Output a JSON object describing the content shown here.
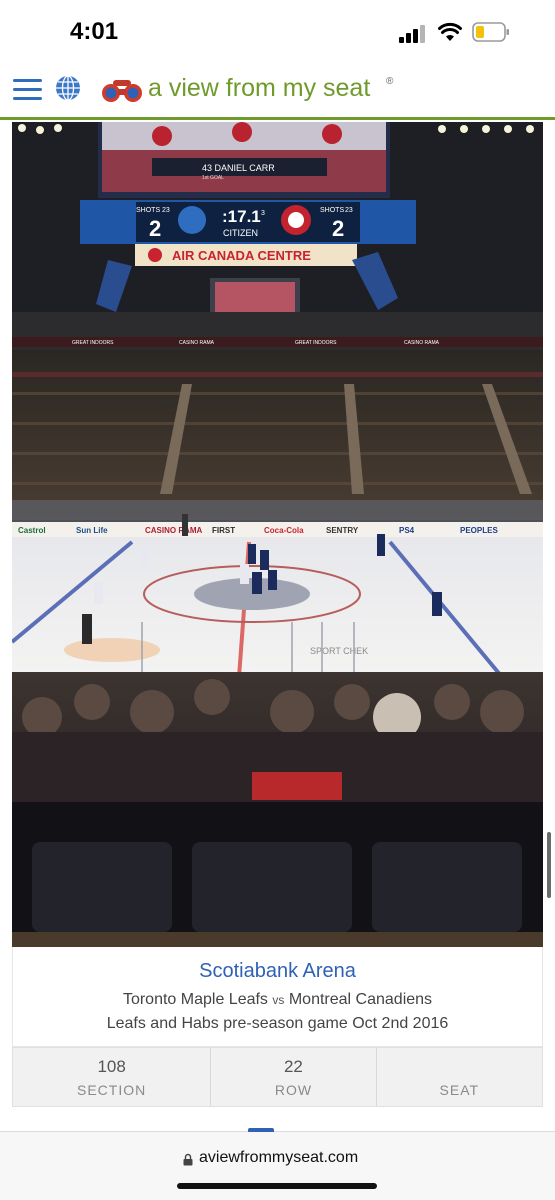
{
  "status_bar": {
    "time": "4:01",
    "icons": [
      "cellular-signal-icon",
      "wifi-icon",
      "battery-low-icon"
    ]
  },
  "header": {
    "menu_icon": "hamburger-menu-icon",
    "globe_icon": "globe-icon",
    "logo_icon": "binoculars-icon",
    "site_name": "a view from my seat",
    "registered_mark": "®",
    "accent_color": "#6f9a2c",
    "link_color": "#2f62b5"
  },
  "photo": {
    "scoreboard": {
      "away_shots_label": "SHOTS",
      "away_shots": "23",
      "away_score": "2",
      "clock": ":17.1",
      "period": "3",
      "sponsor": "CITIZEN",
      "home_shots_label": "SHOTS",
      "home_shots": "23",
      "home_score": "2",
      "player_caption": "43 DANIEL CARR",
      "player_subcaption": "1st GOAL",
      "arena_banner": "AIR CANADA CENTRE"
    },
    "board_ads": [
      "Castrol",
      "Sun Life",
      "CASINO RAMA",
      "FIRST",
      "Coca-Cola",
      "SENTRY",
      "PS4",
      "PEOPLES"
    ],
    "ice_ad": "SPORT CHEK",
    "ring_ads": [
      "GREAT INDOORS",
      "CASINO RAMA",
      "GREAT INDOORS",
      "CASINO RAMA"
    ]
  },
  "caption": {
    "venue": "Scotiabank Arena",
    "home_team": "Toronto Maple Leafs",
    "vs": "vs",
    "away_team": "Montreal Canadiens",
    "description": "Leafs and Habs pre-season game Oct 2nd 2016"
  },
  "seat_info": {
    "section_value": "108",
    "section_label": "SECTION",
    "row_value": "22",
    "row_label": "ROW",
    "seat_value": "",
    "seat_label": "SEAT"
  },
  "browser": {
    "url": "aviewfrommyseat.com",
    "lock_icon": "lock-icon"
  }
}
